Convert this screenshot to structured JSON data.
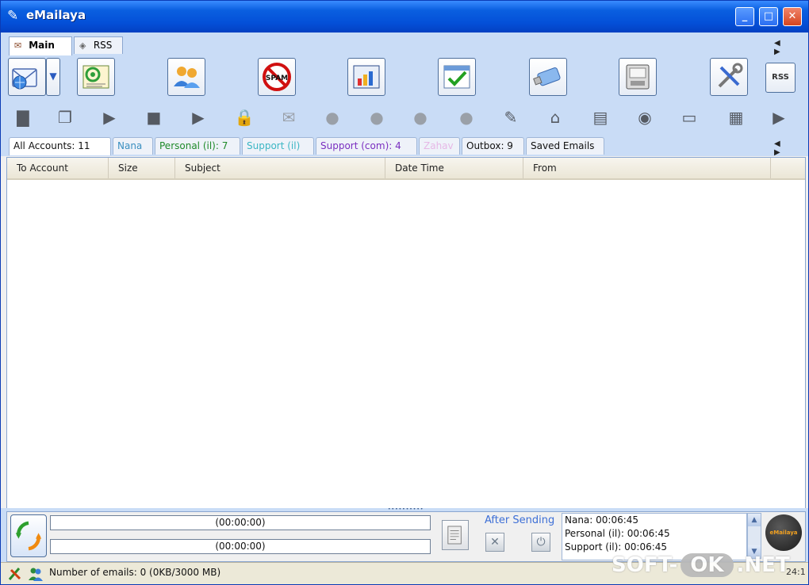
{
  "window": {
    "title": "eMailaya",
    "minimize": "_",
    "maximize": "□",
    "close": "✕"
  },
  "main_tabs": [
    {
      "label": "Main",
      "active": true
    },
    {
      "label": "RSS",
      "active": false
    }
  ],
  "scroll_arrows": "◀ ▶",
  "toolbar_big": [
    {
      "name": "new-mail",
      "icon": "envelope-globe-icon"
    },
    {
      "name": "address-book",
      "icon": "at-sign-card-icon"
    },
    {
      "name": "contacts",
      "icon": "people-icon"
    },
    {
      "name": "spam",
      "icon": "no-spam-icon"
    },
    {
      "name": "statistics",
      "icon": "bar-chart-icon"
    },
    {
      "name": "tasks",
      "icon": "checklist-icon"
    },
    {
      "name": "usb-backup",
      "icon": "usb-drive-icon"
    },
    {
      "name": "storage",
      "icon": "disk-icon"
    },
    {
      "name": "settings",
      "icon": "tools-icon"
    }
  ],
  "rss_button": "RSS",
  "toolbar_small_icons": [
    "folder-icon",
    "copy-icon",
    "video-icon",
    "film-icon",
    "movie-icon",
    "lock-icon",
    "open-mail-icon",
    "user-check-icon",
    "user-move-icon",
    "users-sync-icon",
    "user-chat-icon",
    "edit-doc-icon",
    "network-icon",
    "card-add-icon",
    "disc-icon",
    "printer-icon",
    "grid-icon",
    "exit-icon"
  ],
  "account_tabs": [
    {
      "label": "All Accounts: 11",
      "color": "#111111",
      "active": true
    },
    {
      "label": "Nana",
      "color": "#3a8fc0",
      "active": false
    },
    {
      "label": "Personal (il): 7",
      "color": "#1f8a2a",
      "active": false
    },
    {
      "label": "Support (il)",
      "color": "#3bb6c4",
      "active": false
    },
    {
      "label": "Support (com): 4",
      "color": "#7a2fc0",
      "active": false
    },
    {
      "label": "Zahav",
      "color": "#e6b8e6",
      "active": false
    },
    {
      "label": "Outbox: 9",
      "color": "#111111",
      "active": false
    },
    {
      "label": "Saved Emails",
      "color": "#111111",
      "active": false
    }
  ],
  "table": {
    "columns": [
      "To Account",
      "Size",
      "Subject",
      "Date Time",
      "From"
    ],
    "rows": []
  },
  "bottom": {
    "progress1": "(00:00:00)",
    "progress2": "(00:00:00)",
    "after_sending": "After Sending",
    "timers": [
      "Nana: 00:06:45",
      "Personal (il): 00:06:45",
      "Support (il): 00:06:45"
    ],
    "logo_text": "eMailaya"
  },
  "status": {
    "text": "Number of emails: 0 (0KB/3000 MB)",
    "right": "24:1"
  },
  "watermark": {
    "left": "SOFT-",
    "mid": "OK",
    "right": ".NET"
  }
}
